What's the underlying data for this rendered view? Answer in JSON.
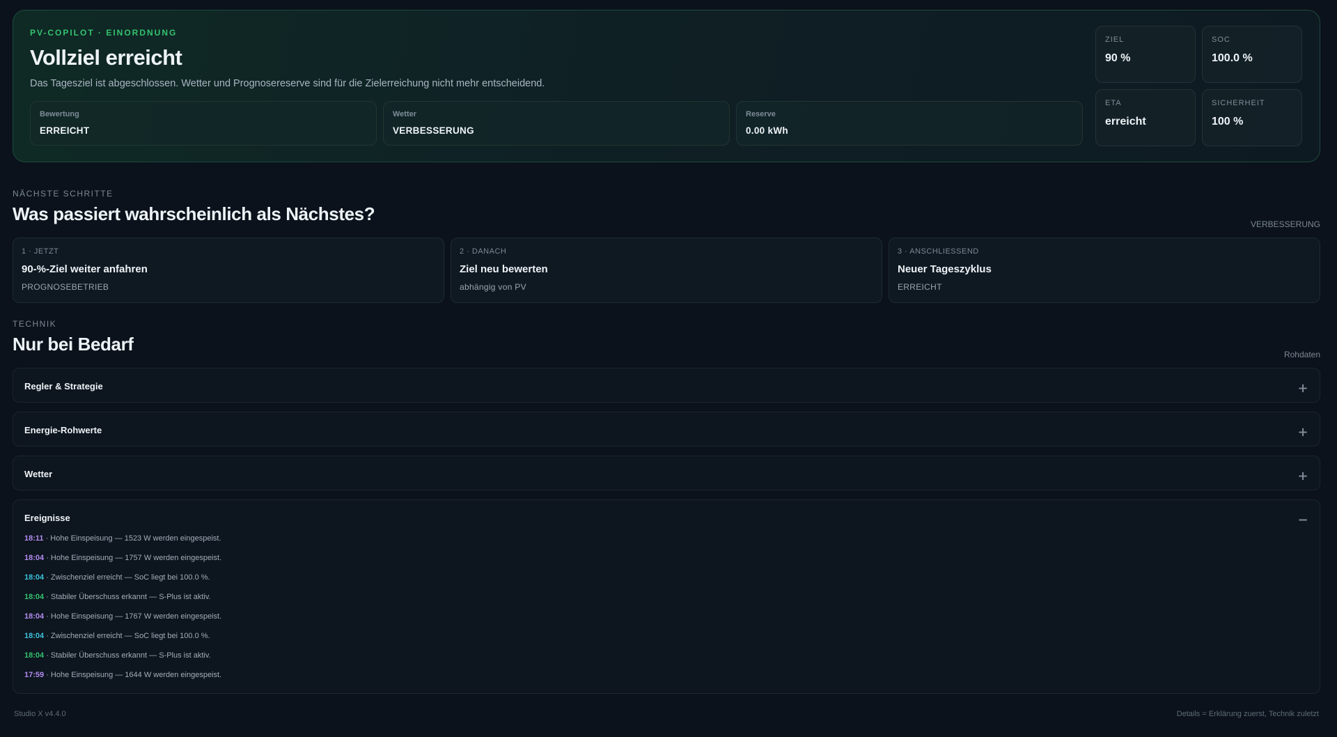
{
  "hero": {
    "kicker": "PV-COPILOT · EINORDNUNG",
    "title": "Vollziel erreicht",
    "text": "Das Tagesziel ist abgeschlossen. Wetter und Prognosereserve sind für die Zielerreichung nicht mehr entscheidend.",
    "metrics": [
      {
        "label": "Bewertung",
        "value": "ERREICHT"
      },
      {
        "label": "Wetter",
        "value": "VERBESSERUNG"
      },
      {
        "label": "Reserve",
        "value": "0.00 kWh"
      }
    ],
    "stats": [
      {
        "label": "ZIEL",
        "value": "90 %"
      },
      {
        "label": "SOC",
        "value": "100.0 %"
      },
      {
        "label": "ETA",
        "value": "erreicht"
      },
      {
        "label": "SICHERHEIT",
        "value": "100 %"
      }
    ]
  },
  "next_steps": {
    "kicker": "NÄCHSTE SCHRITTE",
    "title": "Was passiert wahrscheinlich als Nächstes?",
    "aside": "VERBESSERUNG",
    "steps": [
      {
        "label": "1 · JETZT",
        "title": "90-%-Ziel weiter anfahren",
        "sub": "PROGNOSEBETRIEB"
      },
      {
        "label": "2 · DANACH",
        "title": "Ziel neu bewerten",
        "sub": "abhängig von PV"
      },
      {
        "label": "3 · ANSCHLIESSEND",
        "title": "Neuer Tageszyklus",
        "sub": "ERREICHT"
      }
    ]
  },
  "technik": {
    "kicker": "TECHNIK",
    "title": "Nur bei Bedarf",
    "aside": "Rohdaten",
    "sections": [
      {
        "title": "Regler & Strategie",
        "toggle": "+"
      },
      {
        "title": "Energie-Rohwerte",
        "toggle": "+"
      },
      {
        "title": "Wetter",
        "toggle": "+"
      },
      {
        "title": "Ereignisse",
        "toggle": "−"
      }
    ],
    "events": [
      {
        "time": "18:11",
        "text": " · Hohe Einspeisung — 1523 W werden eingespeist.",
        "color": "#b38cf0"
      },
      {
        "time": "18:04",
        "text": " · Hohe Einspeisung — 1757 W werden eingespeist.",
        "color": "#b38cf0"
      },
      {
        "time": "18:04",
        "text": " · Zwischenziel erreicht — SoC liegt bei 100.0 %.",
        "color": "#3cc4dc"
      },
      {
        "time": "18:04",
        "text": " · Stabiler Überschuss erkannt — S-Plus ist aktiv.",
        "color": "#34c26f"
      },
      {
        "time": "18:04",
        "text": " · Hohe Einspeisung — 1767 W werden eingespeist.",
        "color": "#b38cf0"
      },
      {
        "time": "18:04",
        "text": " · Zwischenziel erreicht — SoC liegt bei 100.0 %.",
        "color": "#3cc4dc"
      },
      {
        "time": "18:04",
        "text": " · Stabiler Überschuss erkannt — S-Plus ist aktiv.",
        "color": "#34c26f"
      },
      {
        "time": "17:59",
        "text": " · Hohe Einspeisung — 1644 W werden eingespeist.",
        "color": "#b38cf0"
      }
    ]
  },
  "footer": {
    "version": "Studio X v4.4.0",
    "hint": "Details = Erklärung zuerst, Technik zuletzt"
  }
}
